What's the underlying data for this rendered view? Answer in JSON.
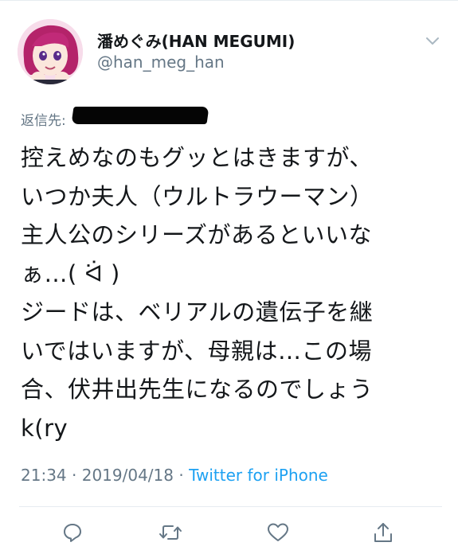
{
  "tweet": {
    "author": {
      "display_name": "潘めぐみ(HAN MEGUMI)",
      "handle": "@han_meg_han",
      "avatar_icon": "avatar-illustration"
    },
    "reply_to_label": "返信先:",
    "reply_to_target": "[redacted]",
    "text_lines": [
      "控えめなのもグッとはきますが、",
      "いつか夫人（ウルトラウーマン）",
      "主人公のシリーズがあるといいな",
      "ぁ…( ᐛ )",
      "ジードは、ベリアルの遺伝子を継",
      "いではいますが、母親は…この場",
      "合、伏井出先生になるのでしょう",
      "k(ry"
    ],
    "time": "21:34",
    "separator": "·",
    "date": "2019/04/18",
    "source": "Twitter for iPhone"
  },
  "actions": {
    "reply_icon": "reply-icon",
    "retweet_icon": "retweet-icon",
    "like_icon": "heart-icon",
    "share_icon": "share-icon"
  },
  "colors": {
    "text": "#14171a",
    "secondary": "#657786",
    "link": "#1da1f2",
    "divider": "#e6ecf0"
  }
}
